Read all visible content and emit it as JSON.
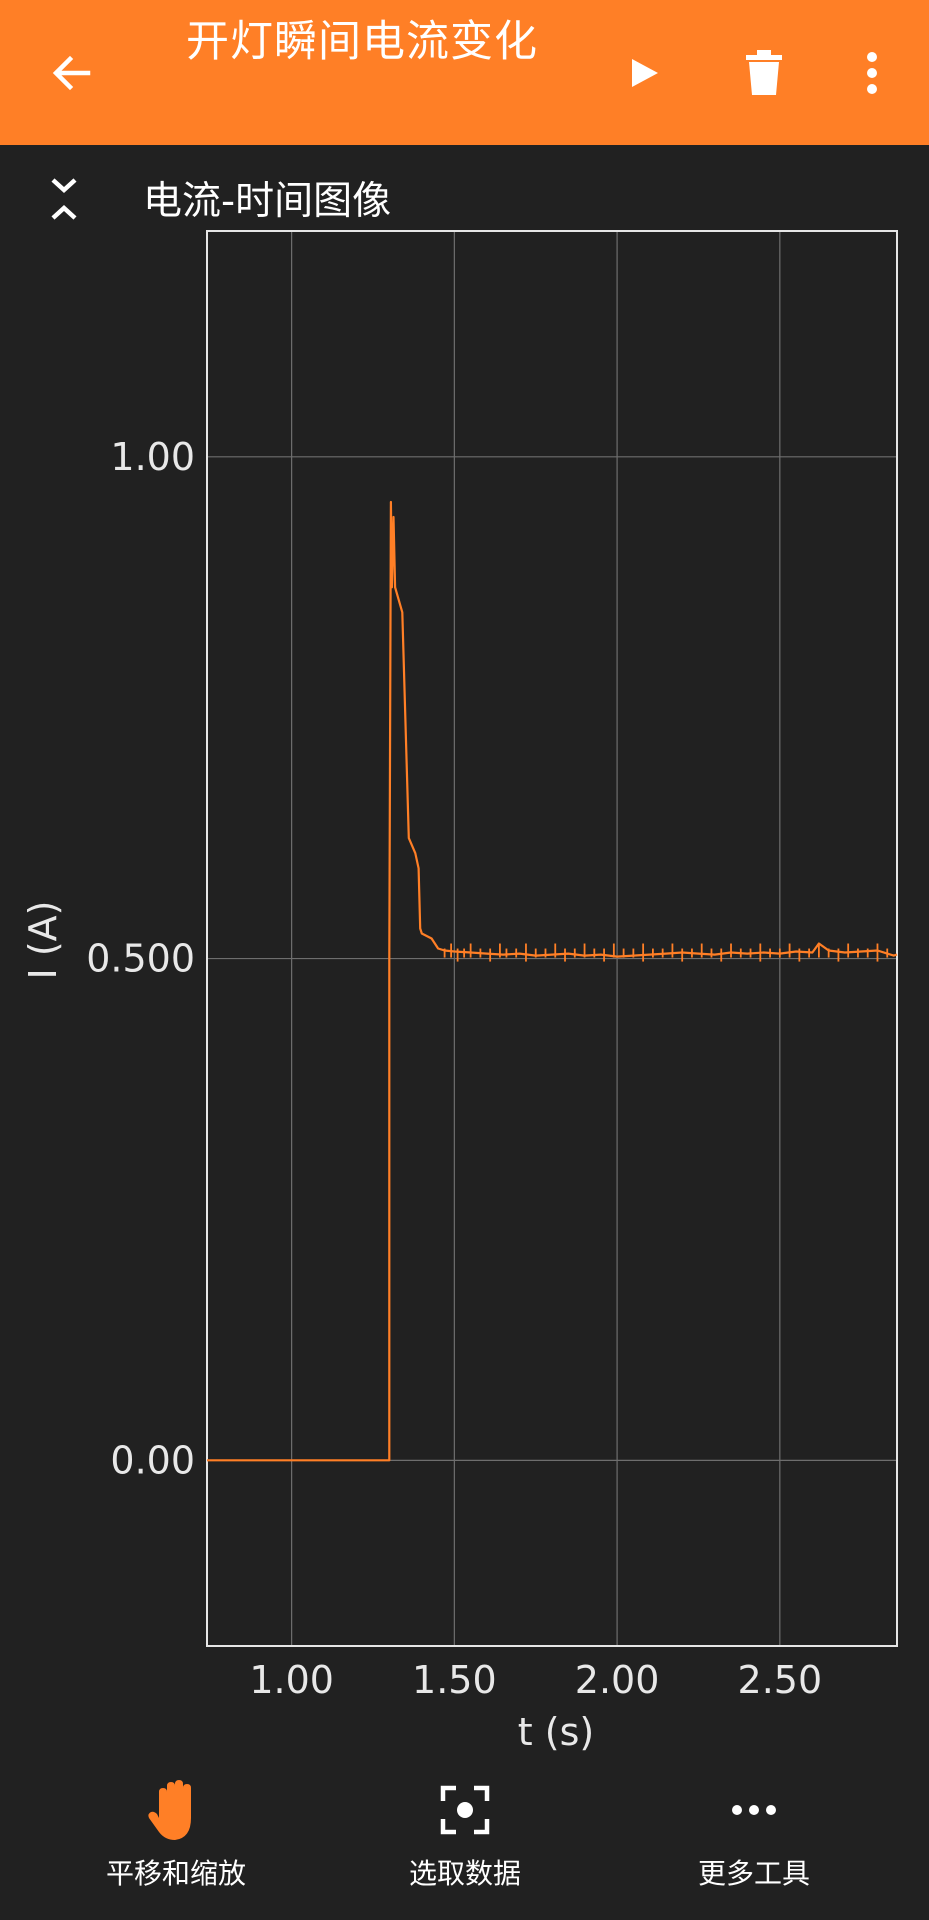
{
  "appbar": {
    "title": "开灯瞬间电流变化",
    "icons": {
      "back": "arrow-left-icon",
      "play": "play-icon",
      "delete": "trash-icon",
      "more": "more-vertical-icon"
    }
  },
  "graph": {
    "title": "电流-时间图像",
    "collapse_icon": "collapse-icon"
  },
  "colors": {
    "accent": "#ff7f26",
    "background": "#212121",
    "grid": "#6e6e6e",
    "text": "#ffffff"
  },
  "chart_data": {
    "type": "line",
    "xlabel": "t (s)",
    "ylabel": "I (A)",
    "xlim": [
      0.74,
      2.86
    ],
    "ylim": [
      -0.185,
      1.225
    ],
    "xticks": [
      1.0,
      1.5,
      2.0,
      2.5
    ],
    "xtick_labels": [
      "1.00",
      "1.50",
      "2.00",
      "2.50"
    ],
    "yticks": [
      0.0,
      0.5,
      1.0
    ],
    "ytick_labels": [
      "0.00",
      "0.500",
      "1.00"
    ],
    "grid": true,
    "series": [
      {
        "color": "#ff7f26",
        "points": [
          [
            0.74,
            0.0
          ],
          [
            1.3,
            0.0
          ],
          [
            1.3,
            0.5
          ],
          [
            1.305,
            0.955
          ],
          [
            1.308,
            0.87
          ],
          [
            1.313,
            0.94
          ],
          [
            1.318,
            0.87
          ],
          [
            1.34,
            0.845
          ],
          [
            1.36,
            0.62
          ],
          [
            1.38,
            0.605
          ],
          [
            1.39,
            0.59
          ],
          [
            1.395,
            0.53
          ],
          [
            1.4,
            0.525
          ],
          [
            1.43,
            0.52
          ],
          [
            1.45,
            0.51
          ],
          [
            1.47,
            0.508
          ],
          [
            1.5,
            0.507
          ],
          [
            1.55,
            0.506
          ],
          [
            1.6,
            0.505
          ],
          [
            1.65,
            0.504
          ],
          [
            1.7,
            0.505
          ],
          [
            1.75,
            0.503
          ],
          [
            1.8,
            0.504
          ],
          [
            1.85,
            0.505
          ],
          [
            1.9,
            0.503
          ],
          [
            1.95,
            0.504
          ],
          [
            2.0,
            0.502
          ],
          [
            2.05,
            0.503
          ],
          [
            2.1,
            0.504
          ],
          [
            2.15,
            0.505
          ],
          [
            2.2,
            0.506
          ],
          [
            2.25,
            0.505
          ],
          [
            2.3,
            0.504
          ],
          [
            2.35,
            0.506
          ],
          [
            2.4,
            0.505
          ],
          [
            2.45,
            0.506
          ],
          [
            2.5,
            0.505
          ],
          [
            2.55,
            0.507
          ],
          [
            2.6,
            0.506
          ],
          [
            2.62,
            0.515
          ],
          [
            2.65,
            0.508
          ],
          [
            2.7,
            0.506
          ],
          [
            2.75,
            0.507
          ],
          [
            2.8,
            0.508
          ],
          [
            2.85,
            0.503
          ],
          [
            2.86,
            0.504
          ]
        ],
        "spikes": [
          1.47,
          1.49,
          1.51,
          1.53,
          1.55,
          1.58,
          1.61,
          1.64,
          1.66,
          1.69,
          1.72,
          1.75,
          1.78,
          1.81,
          1.84,
          1.87,
          1.9,
          1.93,
          1.96,
          1.99,
          2.02,
          2.05,
          2.08,
          2.11,
          2.14,
          2.17,
          2.2,
          2.23,
          2.26,
          2.29,
          2.32,
          2.35,
          2.38,
          2.41,
          2.44,
          2.47,
          2.5,
          2.53,
          2.56,
          2.59,
          2.62,
          2.65,
          2.68,
          2.71,
          2.74,
          2.77,
          2.8,
          2.83
        ]
      }
    ]
  },
  "toolbar": {
    "pan_zoom": {
      "label": "平移和缩放",
      "icon": "hand-icon"
    },
    "select_data": {
      "label": "选取数据",
      "icon": "select-target-icon"
    },
    "more_tools": {
      "label": "更多工具",
      "icon": "more-horizontal-icon"
    }
  }
}
